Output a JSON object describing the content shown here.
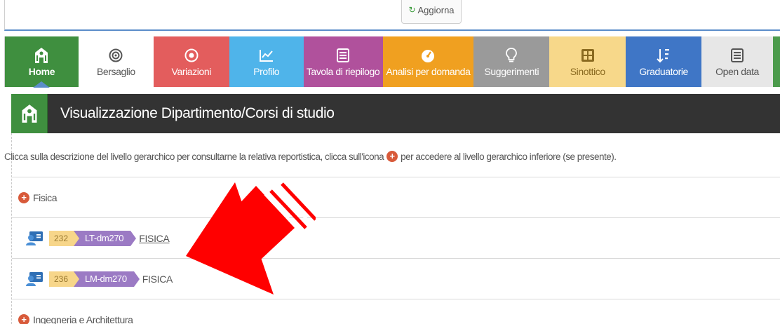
{
  "toolbar": {
    "refresh_label": "Aggiorna"
  },
  "nav": {
    "items": [
      {
        "label": "Home"
      },
      {
        "label": "Bersaglio"
      },
      {
        "label": "Variazioni"
      },
      {
        "label": "Profilo"
      },
      {
        "label": "Tavola di riepilogo"
      },
      {
        "label": "Analisi per domanda"
      },
      {
        "label": "Suggerimenti"
      },
      {
        "label": "Sinottico"
      },
      {
        "label": "Graduatorie"
      },
      {
        "label": "Open data"
      }
    ]
  },
  "header": {
    "title": "Visualizzazione Dipartimento/Corsi di studio"
  },
  "instructions": {
    "before": "Clicca sulla descrizione del livello gerarchico per consultarne la relativa reportistica, clicca sull'icona",
    "after": "per accedere al livello gerarchico inferiore (se presente)."
  },
  "tree": {
    "departments": [
      {
        "name": "Fisica"
      },
      {
        "name": "Ingegneria e Architettura"
      }
    ],
    "courses": [
      {
        "code": "232",
        "class": "LT-dm270",
        "name": "FISICA"
      },
      {
        "code": "236",
        "class": "LM-dm270",
        "name": "FISICA"
      }
    ]
  },
  "colors": {
    "home": "#3f8f3f",
    "variazioni": "#e35d5d",
    "profilo": "#4fb4ea",
    "tavola": "#b0519c",
    "analisi": "#f0a020",
    "suggerimenti": "#9a9a9a",
    "sinottico": "#f7d88a",
    "graduatorie": "#3f76c6",
    "annotation_arrow": "#ff0000"
  }
}
